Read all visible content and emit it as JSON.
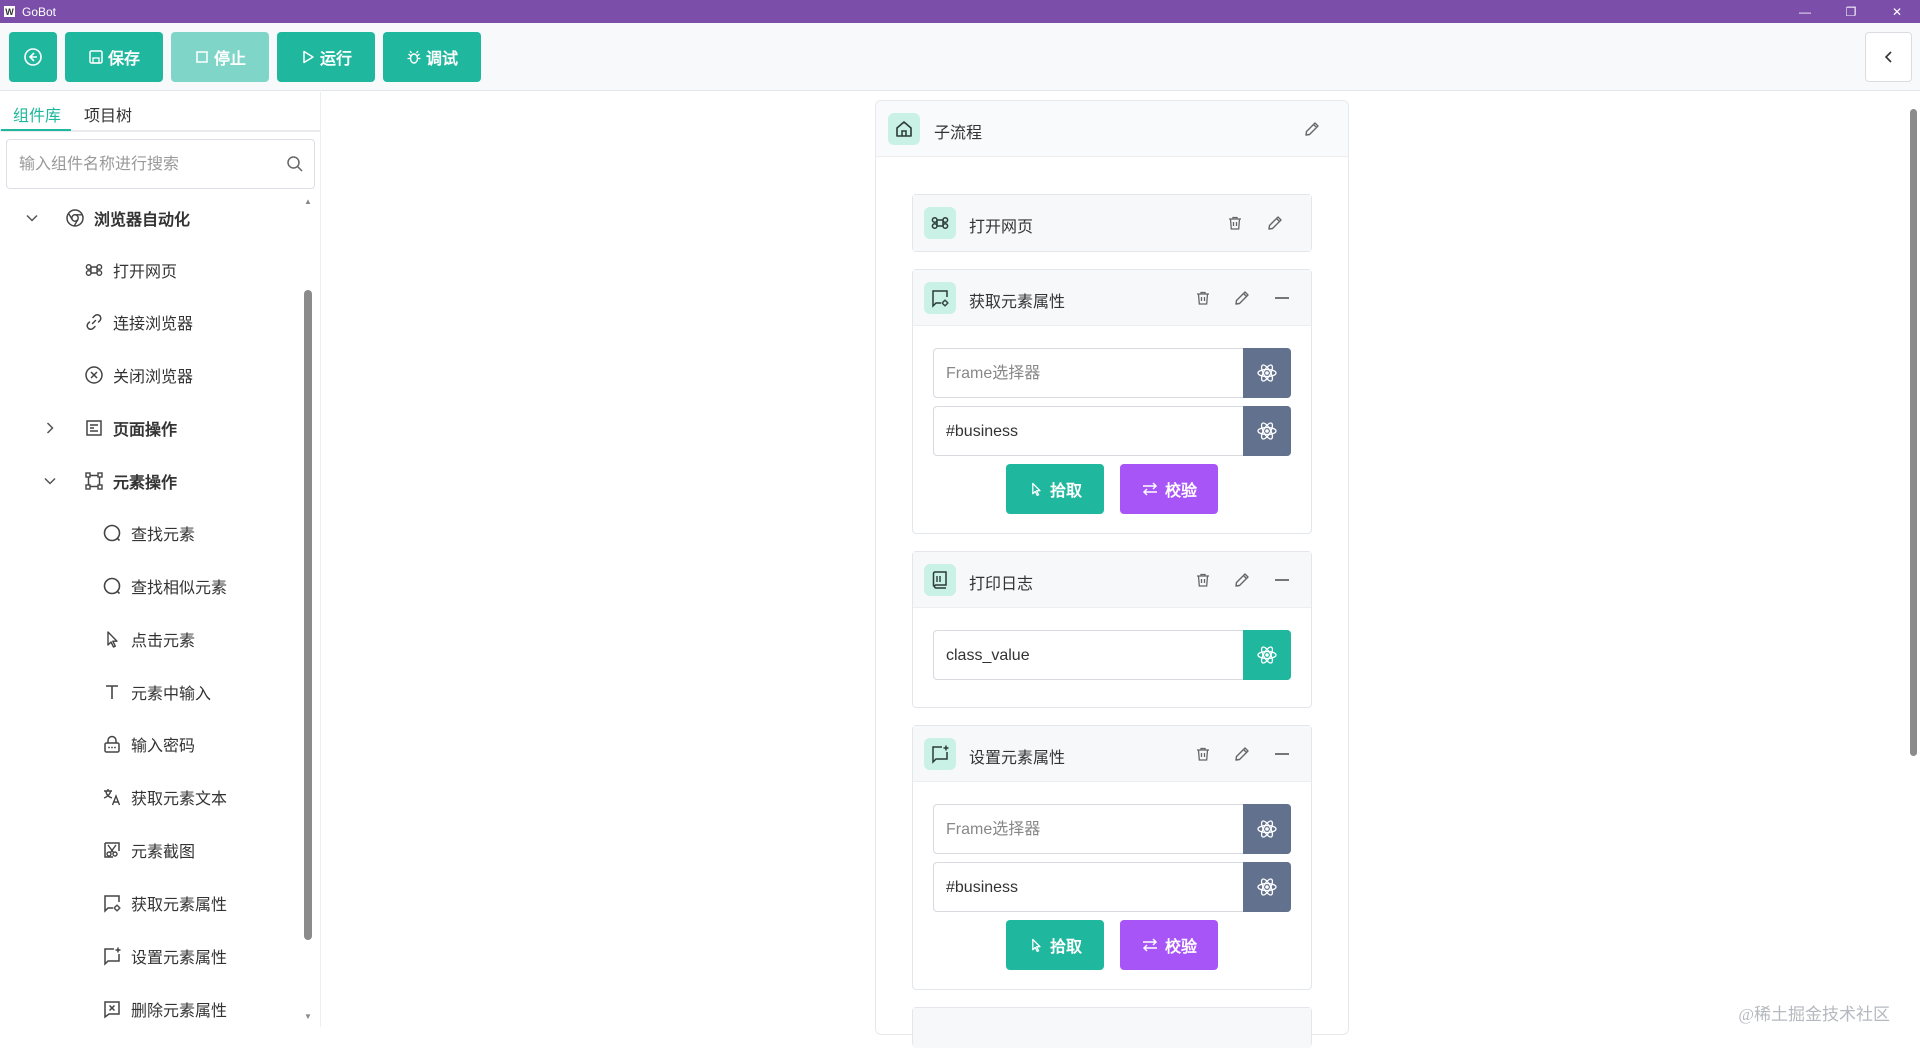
{
  "window": {
    "app_icon": "W",
    "title": "GoBot",
    "controls": [
      "—",
      "❐",
      "✕"
    ]
  },
  "toolbar": {
    "back_icon": "circle-arrow-left-icon",
    "save_label": "保存",
    "stop_label": "停止",
    "run_label": "运行",
    "debug_label": "调试",
    "collapse_icon": "chevron-left-icon"
  },
  "sidebar": {
    "tabs": [
      {
        "label": "组件库",
        "active": true
      },
      {
        "label": "项目树",
        "active": false
      }
    ],
    "search": {
      "placeholder": "输入组件名称进行搜索",
      "value": ""
    },
    "tree": [
      {
        "label": "浏览器自动化",
        "icon": "chrome-icon",
        "type": "category",
        "expanded": true
      },
      {
        "label": "打开网页",
        "icon": "command-icon"
      },
      {
        "label": "连接浏览器",
        "icon": "link-icon"
      },
      {
        "label": "关闭浏览器",
        "icon": "circle-x-icon"
      },
      {
        "label": "页面操作",
        "icon": "page-icon",
        "type": "category",
        "expanded": false
      },
      {
        "label": "元素操作",
        "icon": "frame-icon",
        "type": "category",
        "expanded": true
      },
      {
        "label": "查找元素",
        "icon": "circle-icon"
      },
      {
        "label": "查找相似元素",
        "icon": "circle-icon"
      },
      {
        "label": "点击元素",
        "icon": "pointer-icon"
      },
      {
        "label": "元素中输入",
        "icon": "text-icon"
      },
      {
        "label": "输入密码",
        "icon": "lock-icon"
      },
      {
        "label": "获取元素文本",
        "icon": "translate-icon"
      },
      {
        "label": "元素截图",
        "icon": "screenshot-icon"
      },
      {
        "label": "获取元素属性",
        "icon": "message-gear-icon"
      },
      {
        "label": "设置元素属性",
        "icon": "message-plus-icon"
      },
      {
        "label": "删除元素属性",
        "icon": "square-x-icon"
      }
    ]
  },
  "flow": {
    "title": "子流程",
    "cards": [
      {
        "title": "打开网页",
        "icon": "command-icon",
        "collapsible": false
      },
      {
        "title": "获取元素属性",
        "icon": "message-gear-icon",
        "collapsible": true,
        "fields": [
          {
            "placeholder": "Frame选择器",
            "value": ""
          },
          {
            "placeholder": "",
            "value": "#business"
          }
        ],
        "buttons": {
          "pick": "拾取",
          "verify": "校验"
        }
      },
      {
        "title": "打印日志",
        "icon": "book-icon",
        "collapsible": true,
        "fields": [
          {
            "placeholder": "",
            "value": "class_value"
          }
        ]
      },
      {
        "title": "设置元素属性",
        "icon": "message-plus-icon",
        "collapsible": true,
        "fields": [
          {
            "placeholder": "Frame选择器",
            "value": ""
          },
          {
            "placeholder": "",
            "value": "#business"
          }
        ],
        "buttons": {
          "pick": "拾取",
          "verify": "校验"
        }
      }
    ]
  },
  "colors": {
    "brand": "#1fb79e",
    "purple": "#a855f7",
    "titlebar": "#7b4ea9",
    "atom": "#62718d"
  },
  "watermark": "@稀土掘金技术社区"
}
